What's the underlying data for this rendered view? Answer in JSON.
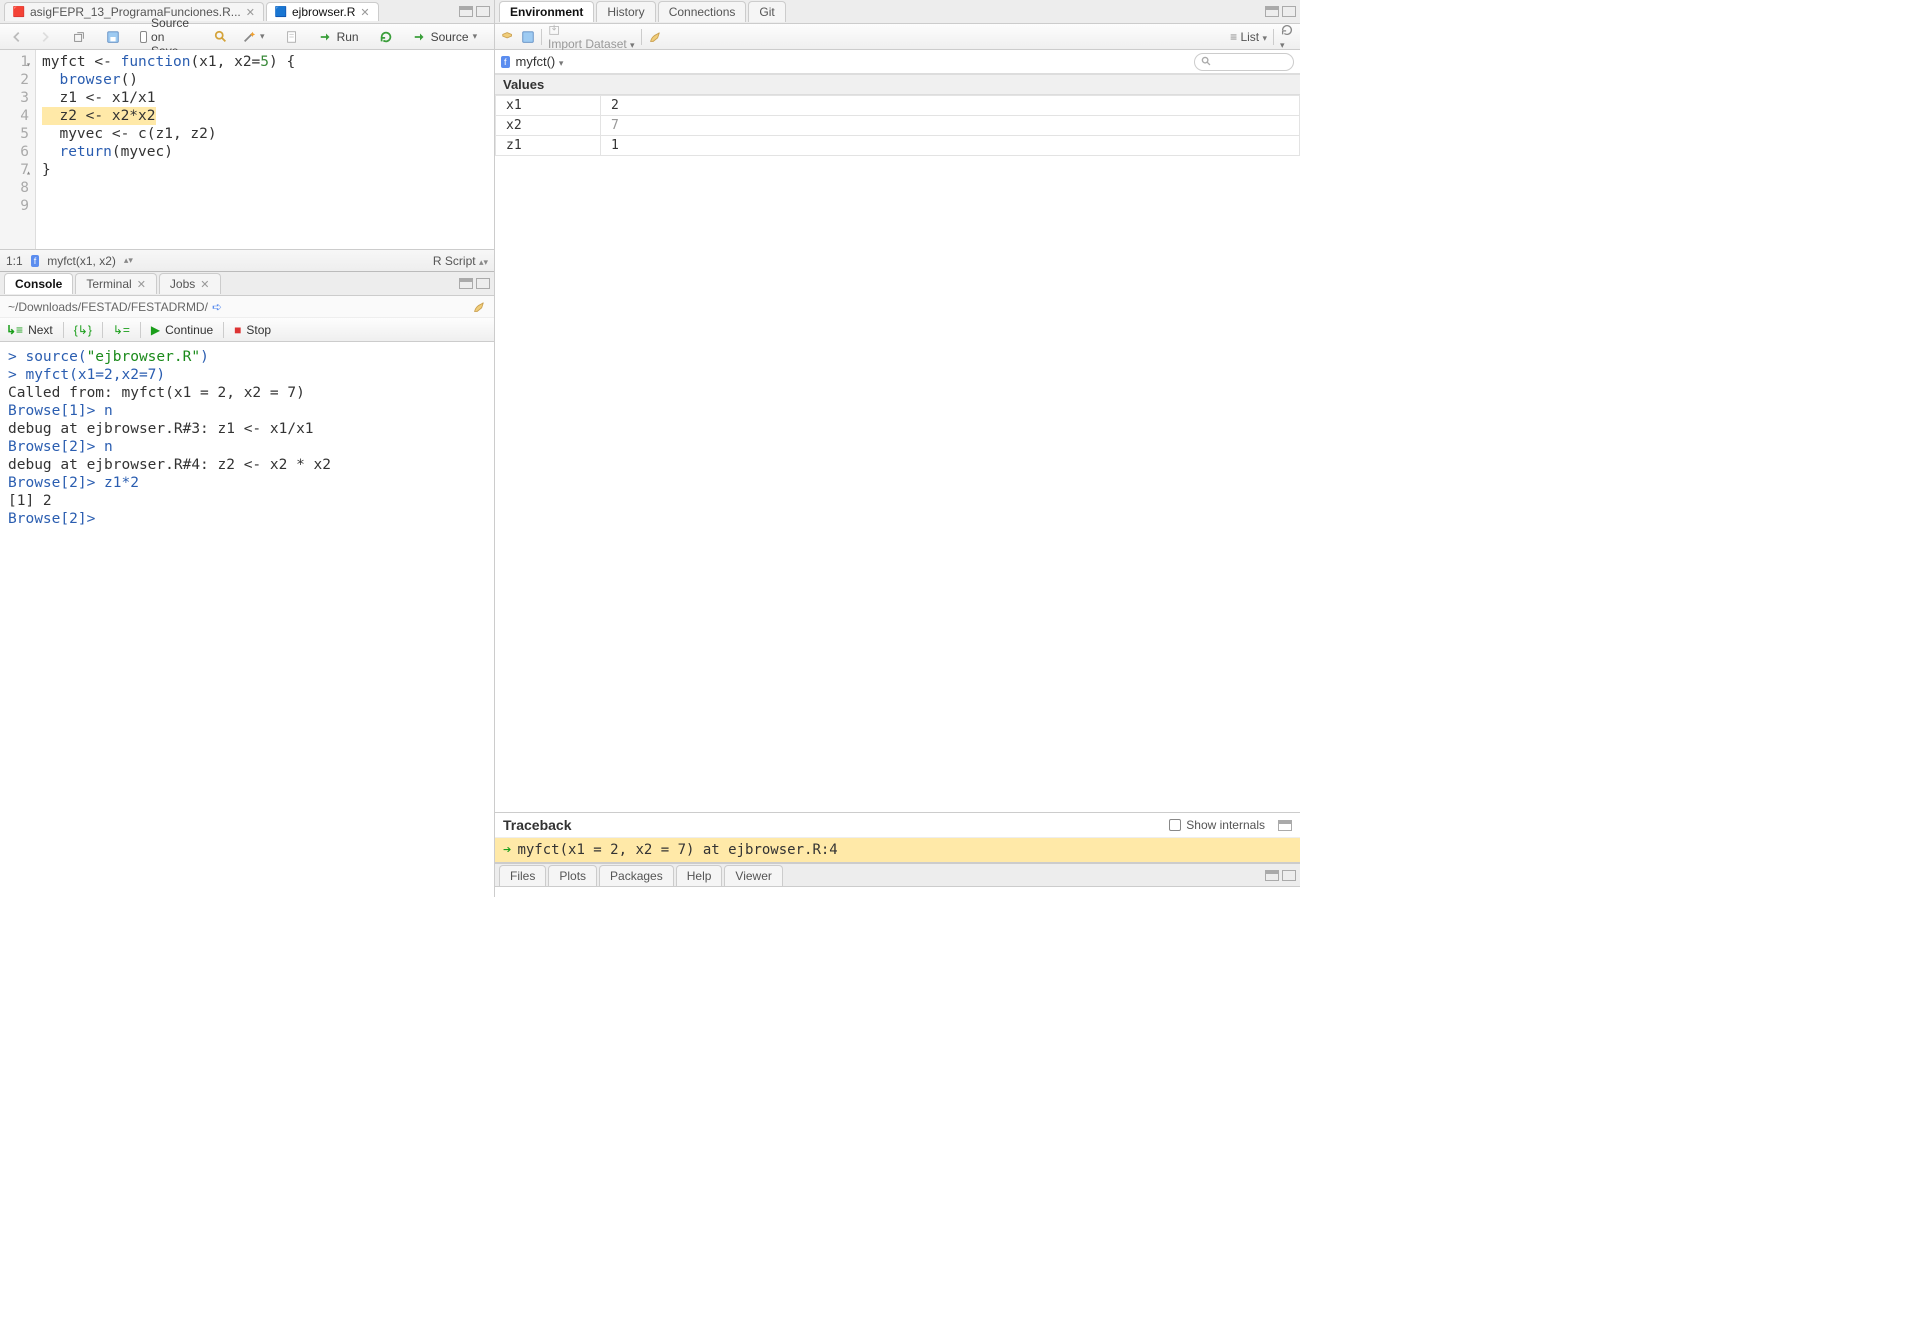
{
  "source": {
    "tabs": [
      {
        "label": "asigFEPR_13_ProgramaFunciones.R..."
      },
      {
        "label": "ejbrowser.R"
      }
    ],
    "toolbar": {
      "source_on_save": "Source on Save",
      "run": "Run",
      "source_btn": "Source"
    },
    "gutter": [
      "1",
      "2",
      "3",
      "4",
      "5",
      "6",
      "7",
      "8",
      "9"
    ],
    "code": {
      "l1_a": "myfct ",
      "l1_op": "<-",
      "l1_kw": " function",
      "l1_b": "(x1, x2",
      "l1_eq": "=",
      "l1_num": "5",
      "l1_c": ") {",
      "l2_a": "  ",
      "l2_fn": "browser",
      "l2_b": "()",
      "l3": "  z1 <- x1/x1",
      "l4": "  z2 <- x2*x2",
      "l5_a": "  myvec ",
      "l5_op": "<-",
      "l5_b": " c(z1, z2)",
      "l6_a": "  ",
      "l6_kw": "return",
      "l6_b": "(myvec)",
      "l7": "}"
    },
    "status": {
      "pos": "1:1",
      "scope": "myfct(x1, x2)",
      "lang": "R Script"
    }
  },
  "console": {
    "tabs": [
      "Console",
      "Terminal",
      "Jobs"
    ],
    "cwd": "~/Downloads/FESTAD/FESTADRMD/",
    "debug": {
      "next": "Next",
      "continue": "Continue",
      "stop": "Stop"
    },
    "lines": [
      {
        "t": "in",
        "prompt": "> ",
        "body": "source(",
        "str": "\"ejbrowser.R\"",
        "after": ")"
      },
      {
        "t": "in",
        "prompt": "> ",
        "body": "myfct(x1=2,x2=7)"
      },
      {
        "t": "out",
        "body": "Called from: myfct(x1 = 2, x2 = 7)"
      },
      {
        "t": "in",
        "prompt": "Browse[1]> ",
        "body": "n"
      },
      {
        "t": "out",
        "body": "debug at ejbrowser.R#3: z1 <- x1/x1"
      },
      {
        "t": "in",
        "prompt": "Browse[2]> ",
        "body": "n"
      },
      {
        "t": "out",
        "body": "debug at ejbrowser.R#4: z2 <- x2 * x2"
      },
      {
        "t": "in",
        "prompt": "Browse[2]> ",
        "body": "z1*2"
      },
      {
        "t": "out",
        "body": "[1] 2"
      },
      {
        "t": "in",
        "prompt": "Browse[2]> ",
        "body": ""
      }
    ]
  },
  "env": {
    "tabs": [
      "Environment",
      "History",
      "Connections",
      "Git"
    ],
    "import": "Import Dataset",
    "list": "List",
    "scope": "myfct()",
    "section": "Values",
    "rows": [
      {
        "name": "x1",
        "value": "2",
        "muted": false
      },
      {
        "name": "x2",
        "value": "7",
        "muted": true
      },
      {
        "name": "z1",
        "value": "1",
        "muted": false
      }
    ],
    "traceback": {
      "title": "Traceback",
      "show_internals": "Show internals",
      "row": "myfct(x1 = 2, x2 = 7) at ejbrowser.R:4"
    }
  },
  "files": {
    "tabs": [
      "Files",
      "Plots",
      "Packages",
      "Help",
      "Viewer"
    ]
  }
}
